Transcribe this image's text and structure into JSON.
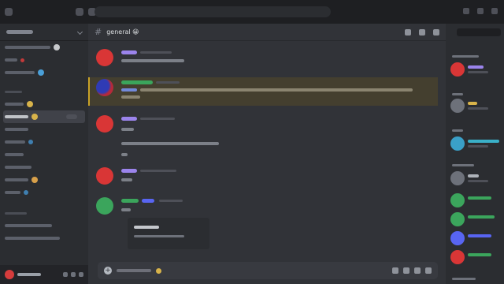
{
  "chat": {
    "channel_title": "general 😀",
    "composer_plus": "+"
  },
  "colors": {
    "background": "#1e1f22",
    "sidebar": "#2b2d31",
    "chat": "#313338",
    "highlight": "#c9a227",
    "avatar_red": "#d93636",
    "avatar_green": "#3ba55c"
  },
  "icons": {
    "composer": [
      "plus-circle-icon",
      "gift-icon",
      "gif-icon",
      "sticker-icon",
      "emoji-icon"
    ],
    "header": [
      "threads-icon",
      "members-icon",
      "inbox-icon"
    ]
  }
}
